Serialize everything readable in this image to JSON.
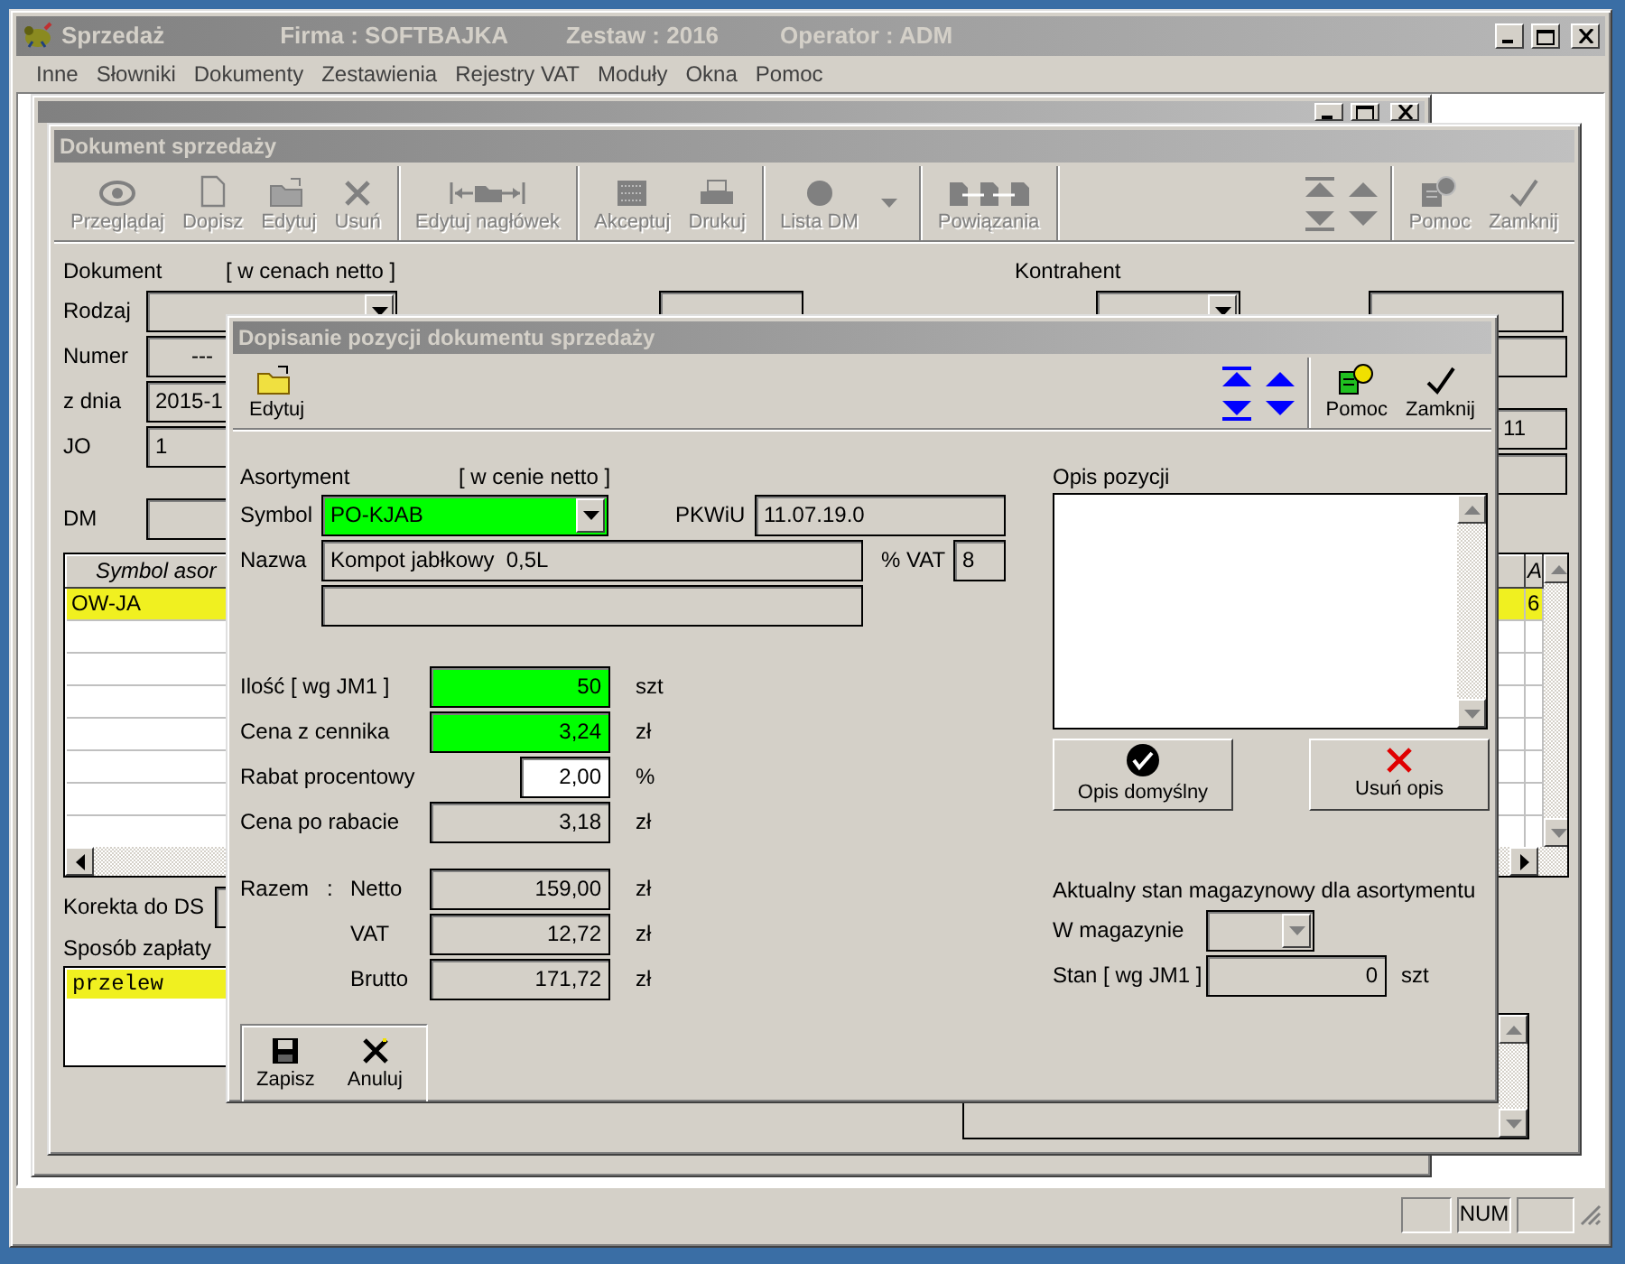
{
  "app": {
    "title": "Sprzedaż",
    "company": "Firma : SOFTBAJKA",
    "set": "Zestaw : 2016",
    "operator": "Operator : ADM"
  },
  "menu": [
    "Inne",
    "Słowniki",
    "Dokumenty",
    "Zestawienia",
    "Rejestry VAT",
    "Moduły",
    "Okna",
    "Pomoc"
  ],
  "document_window": {
    "title": "Dokument sprzedaży",
    "toolbar": [
      {
        "kind": "buttons",
        "items": [
          {
            "label": "Przeglądaj",
            "disabled": true
          },
          {
            "label": "Dopisz",
            "disabled": true
          },
          {
            "label": "Edytuj",
            "disabled": true
          },
          {
            "label": "Usuń",
            "disabled": true
          }
        ]
      },
      {
        "kind": "buttons",
        "items": [
          {
            "label": "Edytuj nagłówek",
            "disabled": true
          }
        ]
      },
      {
        "kind": "buttons",
        "items": [
          {
            "label": "Akceptuj",
            "disabled": true
          },
          {
            "label": "Drukuj",
            "disabled": true
          }
        ]
      },
      {
        "kind": "buttons",
        "items": [
          {
            "label": "Lista DM",
            "disabled": true,
            "menu": true
          }
        ]
      },
      {
        "kind": "buttons",
        "items": [
          {
            "label": "Powiązania",
            "disabled": true
          }
        ]
      },
      {
        "kind": "nav",
        "disabled": true
      },
      {
        "kind": "buttons",
        "items": [
          {
            "label": "Pomoc",
            "disabled": true
          },
          {
            "label": "Zamknij",
            "disabled": true
          }
        ]
      }
    ],
    "document": {
      "heading": "Dokument",
      "note": "[ w cenach netto ]",
      "type_label": "Rodzaj",
      "number_label": "Numer",
      "number": "---",
      "date_label": "z dnia",
      "date": "2015-1",
      "jo_label": "JO",
      "jo": "1",
      "dm_label": "DM"
    },
    "contractor": {
      "heading": "Kontrahent",
      "field_3": "11"
    },
    "items_table": {
      "columns": [
        "Symbol asor",
        "A"
      ],
      "rows": [
        {
          "cells": [
            "OW-JA",
            "6"
          ],
          "selected": true
        }
      ]
    },
    "correction_label": "Korekta do DS",
    "payment": {
      "label": "Sposób zapłaty",
      "options": [
        {
          "label": "przelew",
          "selected": true
        }
      ]
    }
  },
  "dialog": {
    "title": "Dopisanie pozycji dokumentu sprzedaży",
    "toolbar_left": [
      {
        "label": "Edytuj",
        "disabled": false
      }
    ],
    "nav_disabled": false,
    "toolbar_right": [
      {
        "label": "Pomoc",
        "disabled": false
      },
      {
        "label": "Zamknij",
        "disabled": false
      }
    ],
    "item": {
      "heading": "Asortyment",
      "note": "[ w cenie netto ]",
      "symbol_label": "Symbol",
      "symbol": "PO-KJAB",
      "symbol_highlighted": true,
      "pkwiu_label": "PKWiU",
      "pkwiu": "11.07.19.0",
      "name_label": "Nazwa",
      "name": "Kompot jabłkowy  0,5L",
      "vat_label": "% VAT",
      "vat": "8"
    },
    "amounts": [
      {
        "label": "Ilość [ wg JM1 ]",
        "value": "50",
        "unit": "szt",
        "highlighted": true,
        "editable": true
      },
      {
        "label": "Cena z cennika",
        "value": "3,24",
        "unit": "zł",
        "highlighted": true,
        "editable": true
      },
      {
        "label": "Rabat procentowy",
        "value": "2,00",
        "unit": "%",
        "highlighted": false,
        "editable": true
      },
      {
        "label": "Cena po rabacie",
        "value": "3,18",
        "unit": "zł",
        "highlighted": false,
        "editable": false
      }
    ],
    "totals": {
      "label": "Razem",
      "separator": ":",
      "rows": [
        {
          "label": "Netto",
          "value": "159,00",
          "unit": "zł"
        },
        {
          "label": "VAT",
          "value": "12,72",
          "unit": "zł"
        },
        {
          "label": "Brutto",
          "value": "171,72",
          "unit": "zł"
        }
      ]
    },
    "buttons": [
      {
        "label": "Zapisz"
      },
      {
        "label": "Anuluj"
      }
    ],
    "description": {
      "label": "Opis pozycji",
      "buttons": [
        {
          "label": "Opis domyślny"
        },
        {
          "label": "Usuń opis"
        }
      ]
    },
    "stock": {
      "heading": "Aktualny stan magazynowy dla asortymentu",
      "warehouse_label": "W magazynie",
      "warehouse_disabled": true,
      "quantity_label": "Stan [ wg JM1 ]",
      "quantity": "0",
      "unit": "szt"
    }
  },
  "status_bar": {
    "panel_2": "NUM"
  }
}
